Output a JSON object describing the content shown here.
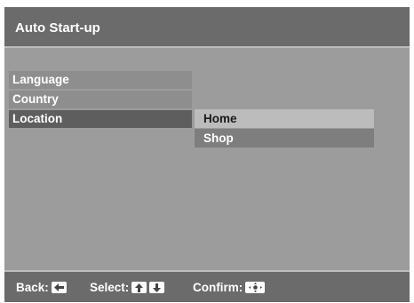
{
  "header": {
    "title": "Auto Start-up"
  },
  "menu": {
    "items": [
      {
        "label": "Language"
      },
      {
        "label": "Country"
      },
      {
        "label": "Location"
      }
    ],
    "selected_index": 2
  },
  "submenu": {
    "items": [
      {
        "label": "Home"
      },
      {
        "label": "Shop"
      }
    ],
    "highlighted_index": 0
  },
  "footer": {
    "back_label": "Back:",
    "select_label": "Select:",
    "confirm_label": "Confirm:",
    "icons": [
      "left-arrow-key-icon",
      "up-arrow-key-icon",
      "down-arrow-key-icon",
      "ok-key-icon"
    ]
  },
  "colors": {
    "screen_bg": "#9c9c9c",
    "bar_bg": "#6b6b6b",
    "menu_item_bg": "#8e8e8e",
    "menu_item_selected_bg": "#5e5e5e",
    "submenu_item_bg": "#7e7e7e",
    "submenu_item_highlight_bg": "#bcbcbc"
  }
}
